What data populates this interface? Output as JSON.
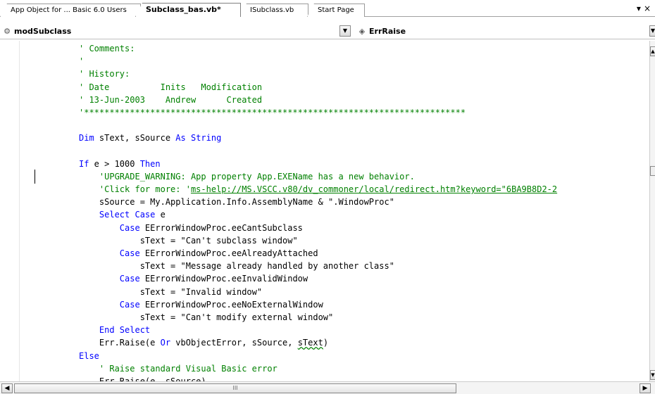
{
  "tabs": [
    {
      "label": "App Object for ... Basic 6.0 Users",
      "active": false
    },
    {
      "label": "Subclass_bas.vb*",
      "active": true
    },
    {
      "label": "ISubclass.vb",
      "active": false
    },
    {
      "label": "Start Page",
      "active": false
    }
  ],
  "tab_controls": {
    "dropdown": "▾",
    "close": "×"
  },
  "navbar": {
    "object_combo": "modSubclass",
    "member_combo": "ErrRaise"
  },
  "scrollbar": {
    "h_thumb_grip": "III"
  },
  "code_lines": [
    {
      "indent": 0,
      "parts": [
        {
          "t": "' Comments:",
          "c": "cm"
        }
      ]
    },
    {
      "indent": 0,
      "parts": [
        {
          "t": "'",
          "c": "cm"
        }
      ]
    },
    {
      "indent": 0,
      "parts": [
        {
          "t": "' History:",
          "c": "cm"
        }
      ]
    },
    {
      "indent": 0,
      "parts": [
        {
          "t": "' Date          Inits   Modification",
          "c": "cm"
        }
      ]
    },
    {
      "indent": 0,
      "parts": [
        {
          "t": "' 13-Jun-2003    Andrew      Created",
          "c": "cm"
        }
      ]
    },
    {
      "indent": 0,
      "parts": [
        {
          "t": "'***************************************************************************",
          "c": "cm"
        }
      ]
    },
    {
      "indent": 0,
      "parts": [
        {
          "t": "",
          "c": ""
        }
      ]
    },
    {
      "indent": 0,
      "parts": [
        {
          "t": "Dim",
          "c": "kw"
        },
        {
          "t": " sText, sSource ",
          "c": ""
        },
        {
          "t": "As",
          "c": "kw"
        },
        {
          "t": " ",
          "c": ""
        },
        {
          "t": "String",
          "c": "kw"
        }
      ]
    },
    {
      "indent": 0,
      "parts": [
        {
          "t": "",
          "c": ""
        }
      ]
    },
    {
      "indent": 0,
      "parts": [
        {
          "t": "If",
          "c": "kw"
        },
        {
          "t": " e > 1000 ",
          "c": ""
        },
        {
          "t": "Then",
          "c": "kw"
        }
      ]
    },
    {
      "indent": 1,
      "parts": [
        {
          "t": "'UPGRADE_WARNING: App property App.EXEName has a new behavior.",
          "c": "cm"
        }
      ]
    },
    {
      "indent": 1,
      "parts": [
        {
          "t": "'Click for more: '",
          "c": "cm"
        },
        {
          "t": "ms-help://MS.VSCC.v80/dv_commoner/local/redirect.htm?keyword=\"6BA9B8D2-2",
          "c": "cm u"
        }
      ]
    },
    {
      "indent": 1,
      "parts": [
        {
          "t": "sSource = My.Application.Info.AssemblyName & \".WindowProc\"",
          "c": ""
        }
      ]
    },
    {
      "indent": 1,
      "parts": [
        {
          "t": "Select Case",
          "c": "kw"
        },
        {
          "t": " e",
          "c": ""
        }
      ]
    },
    {
      "indent": 2,
      "parts": [
        {
          "t": "Case",
          "c": "kw"
        },
        {
          "t": " EErrorWindowProc.eeCantSubclass",
          "c": ""
        }
      ]
    },
    {
      "indent": 3,
      "parts": [
        {
          "t": "sText = \"Can't subclass window\"",
          "c": ""
        }
      ]
    },
    {
      "indent": 2,
      "parts": [
        {
          "t": "Case",
          "c": "kw"
        },
        {
          "t": " EErrorWindowProc.eeAlreadyAttached",
          "c": ""
        }
      ]
    },
    {
      "indent": 3,
      "parts": [
        {
          "t": "sText = \"Message already handled by another class\"",
          "c": ""
        }
      ]
    },
    {
      "indent": 2,
      "parts": [
        {
          "t": "Case",
          "c": "kw"
        },
        {
          "t": " EErrorWindowProc.eeInvalidWindow",
          "c": ""
        }
      ]
    },
    {
      "indent": 3,
      "parts": [
        {
          "t": "sText = \"Invalid window\"",
          "c": ""
        }
      ]
    },
    {
      "indent": 2,
      "parts": [
        {
          "t": "Case",
          "c": "kw"
        },
        {
          "t": " EErrorWindowProc.eeNoExternalWindow",
          "c": ""
        }
      ]
    },
    {
      "indent": 3,
      "parts": [
        {
          "t": "sText = \"Can't modify external window\"",
          "c": ""
        }
      ]
    },
    {
      "indent": 1,
      "parts": [
        {
          "t": "End Select",
          "c": "kw"
        }
      ]
    },
    {
      "indent": 1,
      "parts": [
        {
          "t": "Err.Raise(e ",
          "c": ""
        },
        {
          "t": "Or",
          "c": "kw"
        },
        {
          "t": " vbObjectError, sSource, ",
          "c": ""
        },
        {
          "t": "sText",
          "c": "sq"
        },
        {
          "t": ")",
          "c": ""
        }
      ]
    },
    {
      "indent": 0,
      "parts": [
        {
          "t": "Else",
          "c": "kw"
        }
      ]
    },
    {
      "indent": 1,
      "parts": [
        {
          "t": "' Raise standard Visual Basic error",
          "c": "cm"
        }
      ]
    },
    {
      "indent": 1,
      "parts": [
        {
          "t": "Err.Raise(e, sSource)",
          "c": ""
        }
      ]
    }
  ],
  "colors": {
    "keyword": "#0000ff",
    "comment": "#008000",
    "text": "#000000"
  },
  "icons": {
    "object_combo": "module-icon",
    "member_combo": "method-icon"
  }
}
